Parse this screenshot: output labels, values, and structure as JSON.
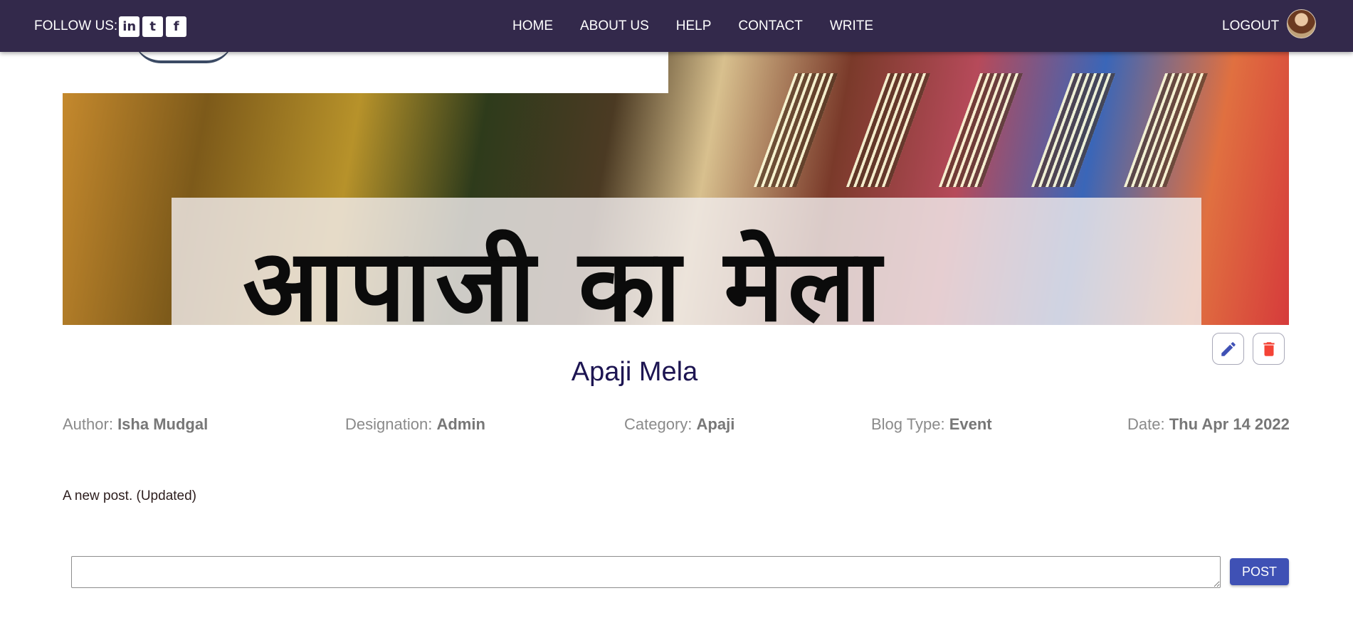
{
  "header": {
    "follow_label": "FOLLOW US:",
    "social": [
      {
        "icon": "linkedin-icon",
        "glyph": "in"
      },
      {
        "icon": "twitter-icon",
        "glyph": "t"
      },
      {
        "icon": "facebook-icon",
        "glyph": "f"
      }
    ],
    "nav": [
      "HOME",
      "ABOUT US",
      "HELP",
      "CONTACT",
      "WRITE"
    ],
    "logout_label": "LOGOUT",
    "bg_color": "#33294b"
  },
  "banner": {
    "overlay_text": "आपाजी का मेला"
  },
  "post": {
    "title": "Apaji Mela",
    "meta": [
      {
        "label": "Author:",
        "value": "Isha Mudgal"
      },
      {
        "label": "Designation:",
        "value": "Admin"
      },
      {
        "label": "Category:",
        "value": "Apaji"
      },
      {
        "label": "Blog Type:",
        "value": "Event"
      },
      {
        "label": "Date:",
        "value": "Thu Apr 14 2022"
      }
    ],
    "description": "A new post. (Updated)"
  },
  "actions": {
    "edit_icon": "pencil-icon",
    "delete_icon": "trash-icon",
    "edit_color": "#3f51b5",
    "delete_color": "#f44336"
  },
  "comment": {
    "value": "",
    "placeholder": "",
    "post_label": "POST",
    "button_color": "#3f51b5"
  }
}
